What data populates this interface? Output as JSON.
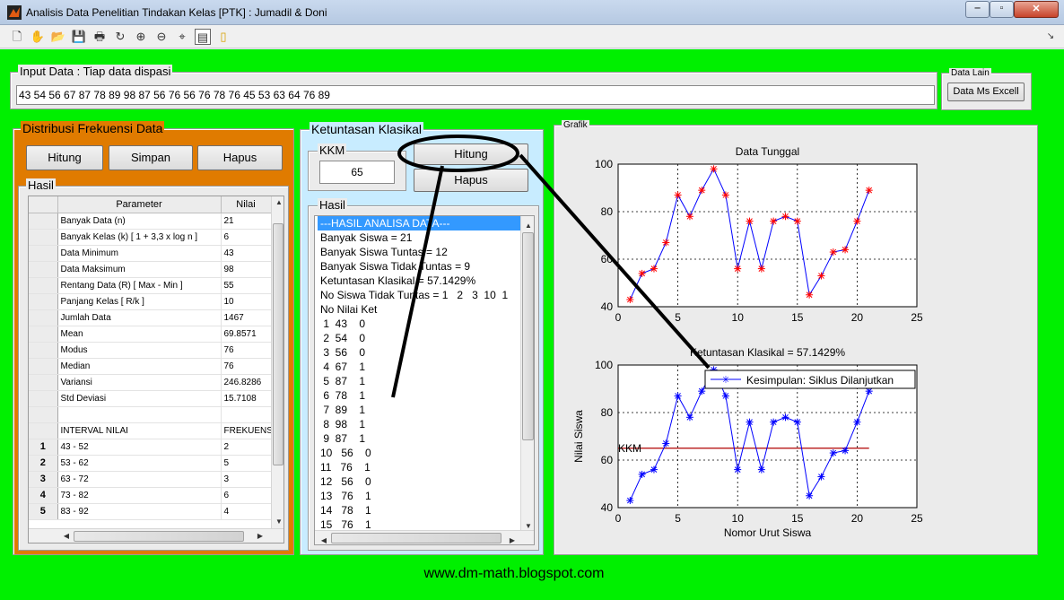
{
  "window": {
    "title": "Analisis Data Penelitian Tindakan Kelas [PTK] : Jumadil & Doni"
  },
  "toolbar": {
    "icons": [
      "new-icon",
      "pan-icon",
      "open-icon",
      "save-icon",
      "print-icon",
      "rotate-icon",
      "zoom-in-icon",
      "zoom-out-icon",
      "data-cursor-icon",
      "plot-tools-icon",
      "window-icon"
    ]
  },
  "input_data": {
    "label": "Input Data : Tiap data dispasi",
    "value": "43 54 56 67 87 78 89 98 87 56 76 56 76 78 76 45 53 63 64 76 89"
  },
  "data_lain": {
    "label": "Data Lain",
    "button": "Data Ms Excell"
  },
  "distribusi": {
    "title": "Distribusi Frekuensi Data",
    "buttons": [
      "Hitung",
      "Simpan",
      "Hapus"
    ],
    "hasil_label": "Hasil",
    "columns": [
      "Parameter",
      "Nilai"
    ],
    "rows": [
      {
        "rh": "",
        "p": "Banyak Data (n)",
        "v": "21"
      },
      {
        "rh": "",
        "p": "Banyak Kelas (k) [ 1 + 3,3 x log n ]",
        "v": "6"
      },
      {
        "rh": "",
        "p": "Data Minimum",
        "v": "43"
      },
      {
        "rh": "",
        "p": "Data Maksimum",
        "v": "98"
      },
      {
        "rh": "",
        "p": "Rentang Data (R) [ Max - Min ]",
        "v": "55"
      },
      {
        "rh": "",
        "p": "Panjang Kelas [ R/k ]",
        "v": "10"
      },
      {
        "rh": "",
        "p": "Jumlah Data",
        "v": "1467"
      },
      {
        "rh": "",
        "p": "Mean",
        "v": "69.8571"
      },
      {
        "rh": "",
        "p": "Modus",
        "v": "76"
      },
      {
        "rh": "",
        "p": "Median",
        "v": "76"
      },
      {
        "rh": "",
        "p": "Variansi",
        "v": "246.8286"
      },
      {
        "rh": "",
        "p": "Std Deviasi",
        "v": "15.7108"
      },
      {
        "rh": "",
        "p": "",
        "v": ""
      },
      {
        "rh": "",
        "p": "INTERVAL NILAI",
        "v": "FREKUENSI"
      },
      {
        "rh": "1",
        "p": "43 - 52",
        "v": "2"
      },
      {
        "rh": "2",
        "p": "53 - 62",
        "v": "5"
      },
      {
        "rh": "3",
        "p": "63 - 72",
        "v": "3"
      },
      {
        "rh": "4",
        "p": "73 - 82",
        "v": "6"
      },
      {
        "rh": "5",
        "p": "83 - 92",
        "v": "4"
      }
    ]
  },
  "ketuntasan": {
    "title": "Ketuntasan Klasikal",
    "kkm_label": "KKM",
    "kkm_value": "65",
    "hitung": "Hitung",
    "hapus": "Hapus",
    "hasil_label": "Hasil",
    "lines": [
      "---HASIL ANALISA DATA---",
      "Banyak Siswa = 21",
      "Banyak Siswa Tuntas = 12",
      "Banyak Siswa Tidak Tuntas = 9",
      "Ketuntasan Klasikal = 57.1429%",
      "No Siswa Tidak Tuntas = 1   2   3  10  1",
      "No Nilai Ket",
      " 1  43    0",
      " 2  54    0",
      " 3  56    0",
      " 4  67    1",
      " 5  87    1",
      " 6  78    1",
      " 7  89    1",
      " 8  98    1",
      " 9  87    1",
      "10   56    0",
      "11   76    1",
      "12   56    0",
      "13   76    1",
      "14   78    1",
      "15   76    1"
    ]
  },
  "grafik": {
    "label": "Grafik"
  },
  "footer": {
    "url": "www.dm-math.blogspot.com"
  },
  "colors": {
    "figure_bg": "#00f000",
    "panel_orange": "#e07b00",
    "panel_blue": "#c8ecff",
    "line_blue": "#0000ff",
    "marker_red": "#ff0000",
    "kkm_line": "#b00000"
  },
  "chart_data": [
    {
      "type": "line",
      "title": "Data Tunggal",
      "xlabel": "",
      "ylabel": "",
      "x": [
        1,
        2,
        3,
        4,
        5,
        6,
        7,
        8,
        9,
        10,
        11,
        12,
        13,
        14,
        15,
        16,
        17,
        18,
        19,
        20,
        21
      ],
      "series": [
        {
          "values": [
            43,
            54,
            56,
            67,
            87,
            78,
            89,
            98,
            87,
            56,
            76,
            56,
            76,
            78,
            76,
            45,
            53,
            63,
            64,
            76,
            89
          ]
        }
      ],
      "xlim": [
        0,
        25
      ],
      "ylim": [
        40,
        100
      ],
      "xticks": [
        "0",
        "5",
        "10",
        "15",
        "20",
        "25"
      ],
      "yticks": [
        "40",
        "60",
        "80",
        "100"
      ],
      "grid": true
    },
    {
      "type": "line",
      "title": "Ketuntasan Klasikal = 57.1429%",
      "xlabel": "Nomor Urut Siswa",
      "ylabel": "Nilai Siswa",
      "x": [
        1,
        2,
        3,
        4,
        5,
        6,
        7,
        8,
        9,
        10,
        11,
        12,
        13,
        14,
        15,
        16,
        17,
        18,
        19,
        20,
        21
      ],
      "series": [
        {
          "values": [
            43,
            54,
            56,
            67,
            87,
            78,
            89,
            98,
            87,
            56,
            76,
            56,
            76,
            78,
            76,
            45,
            53,
            63,
            64,
            76,
            89
          ]
        }
      ],
      "reference_line": {
        "label": "KKM",
        "value": 65
      },
      "legend": {
        "text": "Kesimpulan: Siklus Dilanjutkan",
        "position": "top-right"
      },
      "xlim": [
        0,
        25
      ],
      "ylim": [
        40,
        100
      ],
      "xticks": [
        "0",
        "5",
        "10",
        "15",
        "20",
        "25"
      ],
      "yticks": [
        "40",
        "60",
        "80",
        "100"
      ],
      "grid": true
    }
  ]
}
